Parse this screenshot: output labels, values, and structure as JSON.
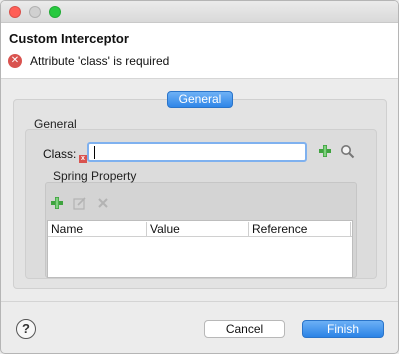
{
  "window": {
    "header_title": "Custom Interceptor",
    "error_message": "Attribute 'class' is required"
  },
  "tabs": {
    "active": "General"
  },
  "general": {
    "legend": "General",
    "class_label": "Class:",
    "class_value": "",
    "spring_legend": "Spring Property",
    "table_columns": [
      "Name",
      "Value",
      "Reference"
    ]
  },
  "footer": {
    "help": "?",
    "cancel": "Cancel",
    "finish": "Finish"
  },
  "colors": {
    "accent": "#2f86e8",
    "error": "#d9534f",
    "add_green": "#3fa33f"
  }
}
